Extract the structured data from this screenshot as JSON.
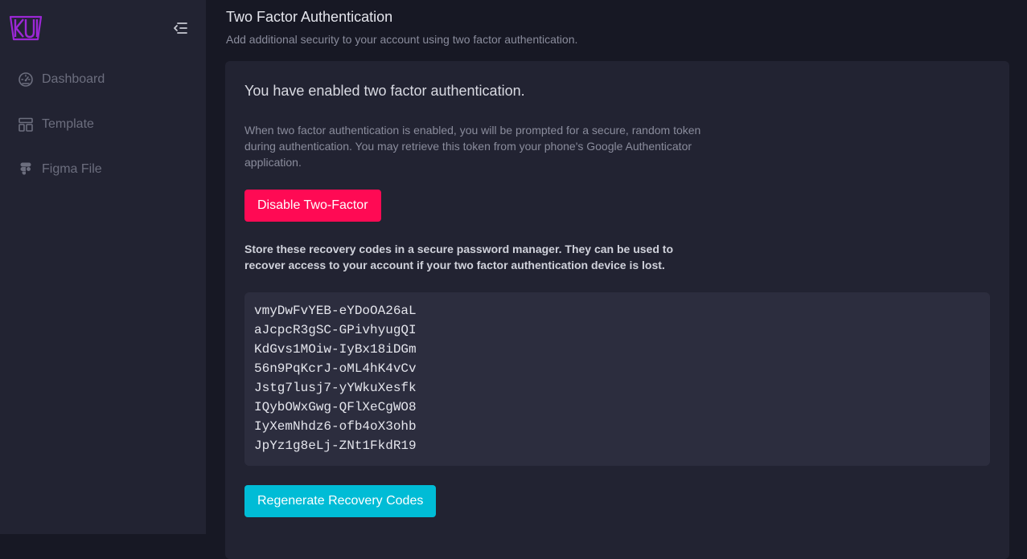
{
  "sidebar": {
    "logo_text": "KUI",
    "brand_color": "#9c27d6",
    "collapse_icon": "menu-collapse-icon",
    "items": [
      {
        "label": "Dashboard",
        "icon": "dashboard-gauge-icon"
      },
      {
        "label": "Template",
        "icon": "template-layout-icon"
      },
      {
        "label": "Figma File",
        "icon": "figma-icon"
      }
    ]
  },
  "section": {
    "title": "Two Factor Authentication",
    "description": "Add additional security to your account using two factor authentication."
  },
  "card": {
    "status_heading": "You have enabled two factor authentication.",
    "explanation": "When two factor authentication is enabled, you will be prompted for a secure, random token during authentication. You may retrieve this token from your phone's Google Authenticator application.",
    "disable_button": "Disable Two-Factor",
    "store_note": "Store these recovery codes in a secure password manager. They can be used to recover access to your account if your two factor authentication device is lost.",
    "recovery_codes": [
      "vmyDwFvYEB-eYDoOA26aL",
      "aJcpcR3gSC-GPivhyugQI",
      "KdGvs1MOiw-IyBx18iDGm",
      "56n9PqKcrJ-oML4hK4vCv",
      "Jstg7lusj7-yYWkuXesfk",
      "IQybOWxGwg-QFlXeCgWO8",
      "IyXemNhdz6-ofb4oX3ohb",
      "JpYz1g8eLj-ZNt1FkdR19"
    ],
    "regenerate_button": "Regenerate Recovery Codes"
  },
  "colors": {
    "danger": "#ff0a54",
    "info": "#00bcd6",
    "sidebar_bg": "#222332",
    "page_bg": "#171824"
  }
}
